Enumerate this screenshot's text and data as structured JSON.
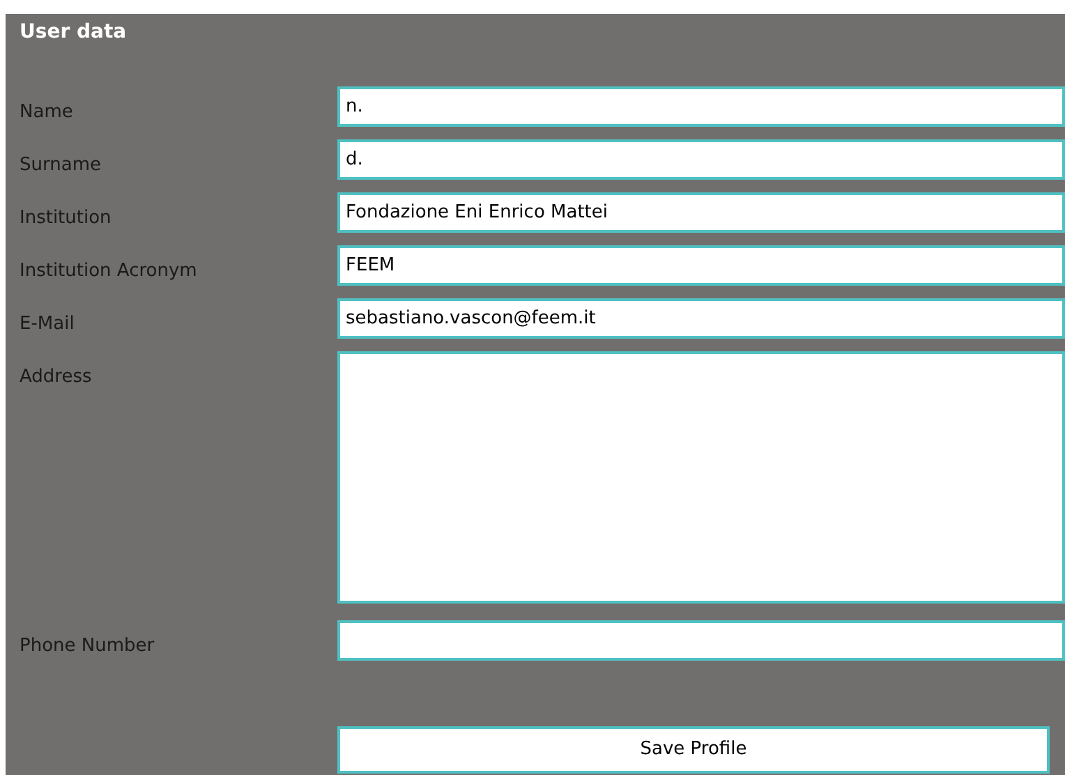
{
  "panel": {
    "title": "User data"
  },
  "fields": [
    {
      "kind": "input",
      "label": "Name",
      "value": "n."
    },
    {
      "kind": "input",
      "label": "Surname",
      "value": "d."
    },
    {
      "kind": "input",
      "label": "Institution",
      "value": "Fondazione Eni Enrico Mattei"
    },
    {
      "kind": "input",
      "label": "Institution Acronym",
      "value": "FEEM"
    },
    {
      "kind": "input",
      "label": "E-Mail",
      "value": "sebastiano.vascon@feem.it"
    },
    {
      "kind": "textarea",
      "label": "Address"
    },
    {
      "kind": "input",
      "label": "Phone Number"
    }
  ],
  "save_button": "Save Profile"
}
